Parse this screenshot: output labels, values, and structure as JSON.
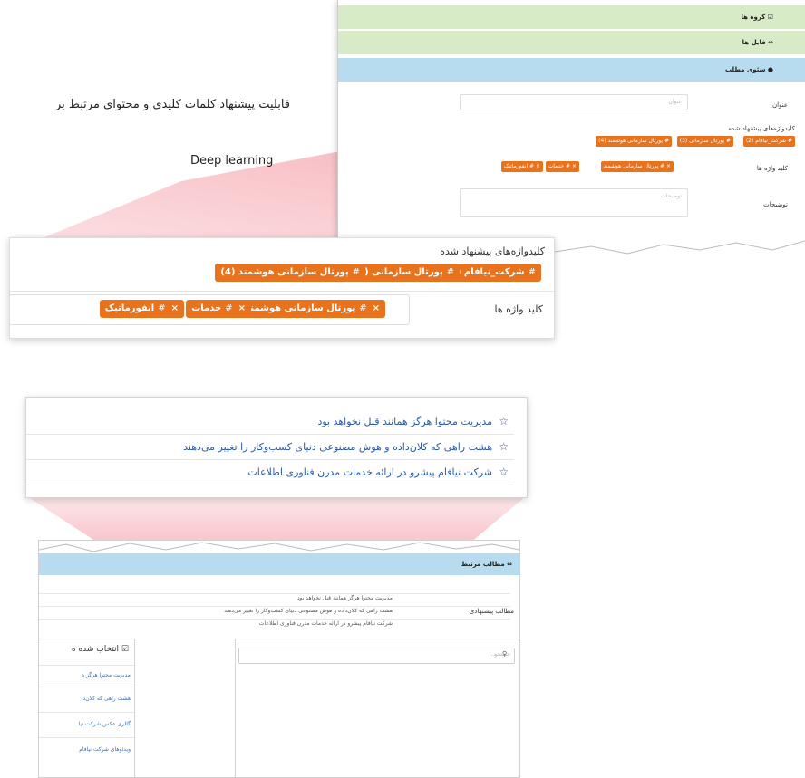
{
  "headline": "قابلیت پیشنهاد کلمات کلیدی و محتوای مرتبط بر",
  "subline": "Deep learning",
  "top_panel": {
    "band_groups": "گروه ها",
    "band_files": "فایل ها",
    "band_seo": "سئوی مطلب",
    "title_label": "عنوان",
    "title_placeholder": "عنوان",
    "suggested_label": "کلیدواژه‌های پیشنهاد شده",
    "keywords_label": "کلید واژه ها",
    "description_label": "توضیحات",
    "description_placeholder": "توضیحات",
    "suggested": [
      "# شرکت_نیافام (2)",
      "# پورتال سازمانی (3)",
      "# پورتال سازمانی هوشمند (4)"
    ],
    "keywords": [
      "× # پورتال سازمانی هوشمند",
      "× # خدمات",
      "× # انفورماتیک"
    ]
  },
  "zoom_keywords": {
    "suggested_label": "کلیدواژه‌های پیشنهاد شده",
    "keywords_label": "کلید واژه ها",
    "suggested": [
      {
        "text": "شرکت_نیافام (2)"
      },
      {
        "text": "پورتال سازمانی (3)"
      },
      {
        "text": "پورتال سازمانی هوشمند (4)"
      }
    ],
    "keywords": [
      {
        "text": "پورتال سازمانی هوشمند"
      },
      {
        "text": "خدمات"
      },
      {
        "text": "انفورماتیک"
      }
    ],
    "hash": "#",
    "remove": "×"
  },
  "zoom_related": {
    "items": [
      "مدیریت محتوا هرگز همانند قبل نخواهد بود",
      "هشت راهی که کلان‌داده و هوش مصنوعی دنیای کسب‌وکار را تغییر می‌دهند",
      "شرکت نیافام پیشرو در ارائه خدمات مدرن فناوری اطلاعات"
    ],
    "star": "☆"
  },
  "bottom_panel": {
    "band_title": "مطالب مرتبط",
    "suggested_label": "مطالب پیشنهادی",
    "search_placeholder": "جستجو...",
    "selected_title": "انتخاب شده ه",
    "selected_items": [
      "مدیریت محتوا هرگز ه",
      "هشت راهی که کلان‌دا",
      "گالری عکس شرکت نیا",
      "ویدئوهای شرکت نیافام"
    ]
  },
  "colors": {
    "chip": "#e8731c",
    "link": "#2b5aa0",
    "green_band": "#d7ecc6",
    "blue_band": "#b7dcef",
    "pink": "#f28b96"
  }
}
